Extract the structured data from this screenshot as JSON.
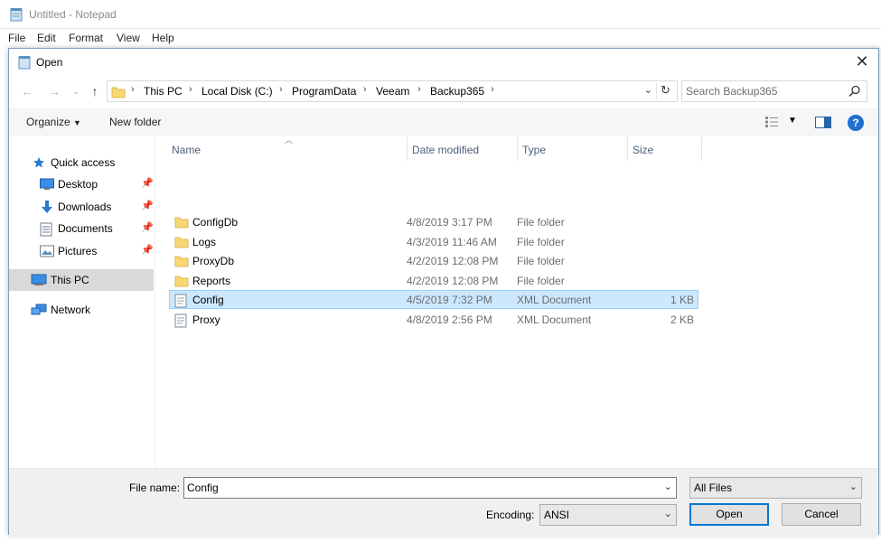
{
  "notepad": {
    "title": "Untitled - Notepad",
    "menu": [
      "File",
      "Edit",
      "Format",
      "View",
      "Help"
    ]
  },
  "dialog": {
    "title": "Open",
    "close_icon": "close-icon"
  },
  "address_bar": {
    "crumbs": [
      "This PC",
      "Local Disk (C:)",
      "ProgramData",
      "Veeam",
      "Backup365"
    ]
  },
  "search": {
    "placeholder": "Search Backup365"
  },
  "toolbar": {
    "organize_label": "Organize",
    "new_folder_label": "New folder"
  },
  "nav_pane": {
    "quick_access": "Quick access",
    "items": [
      {
        "label": "Desktop",
        "icon": "desktop-icon",
        "pinned": true
      },
      {
        "label": "Downloads",
        "icon": "downloads-icon",
        "pinned": true
      },
      {
        "label": "Documents",
        "icon": "documents-icon",
        "pinned": true
      },
      {
        "label": "Pictures",
        "icon": "pictures-icon",
        "pinned": true
      }
    ],
    "this_pc": "This PC",
    "network": "Network"
  },
  "file_list": {
    "columns": [
      "Name",
      "Date modified",
      "Type",
      "Size"
    ],
    "rows": [
      {
        "name": "ConfigDb",
        "date": "4/8/2019 3:17 PM",
        "type": "File folder",
        "size": "",
        "kind": "folder"
      },
      {
        "name": "Logs",
        "date": "4/3/2019 11:46 AM",
        "type": "File folder",
        "size": "",
        "kind": "folder"
      },
      {
        "name": "ProxyDb",
        "date": "4/2/2019 12:08 PM",
        "type": "File folder",
        "size": "",
        "kind": "folder"
      },
      {
        "name": "Reports",
        "date": "4/2/2019 12:08 PM",
        "type": "File folder",
        "size": "",
        "kind": "folder"
      },
      {
        "name": "Config",
        "date": "4/5/2019 7:32 PM",
        "type": "XML Document",
        "size": "1 KB",
        "kind": "xml",
        "selected": true
      },
      {
        "name": "Proxy",
        "date": "4/8/2019 2:56 PM",
        "type": "XML Document",
        "size": "2 KB",
        "kind": "xml"
      }
    ]
  },
  "bottom": {
    "file_name_label": "File name:",
    "file_name_value": "Config",
    "file_type": "All Files",
    "encoding_label": "Encoding:",
    "encoding_value": "ANSI",
    "open_label": "Open",
    "cancel_label": "Cancel"
  },
  "colors": {
    "selection_bg": "#cce8ff",
    "selection_border": "#99d1ff",
    "folder_yellow": "#f8d775",
    "accent": "#0078d7"
  }
}
